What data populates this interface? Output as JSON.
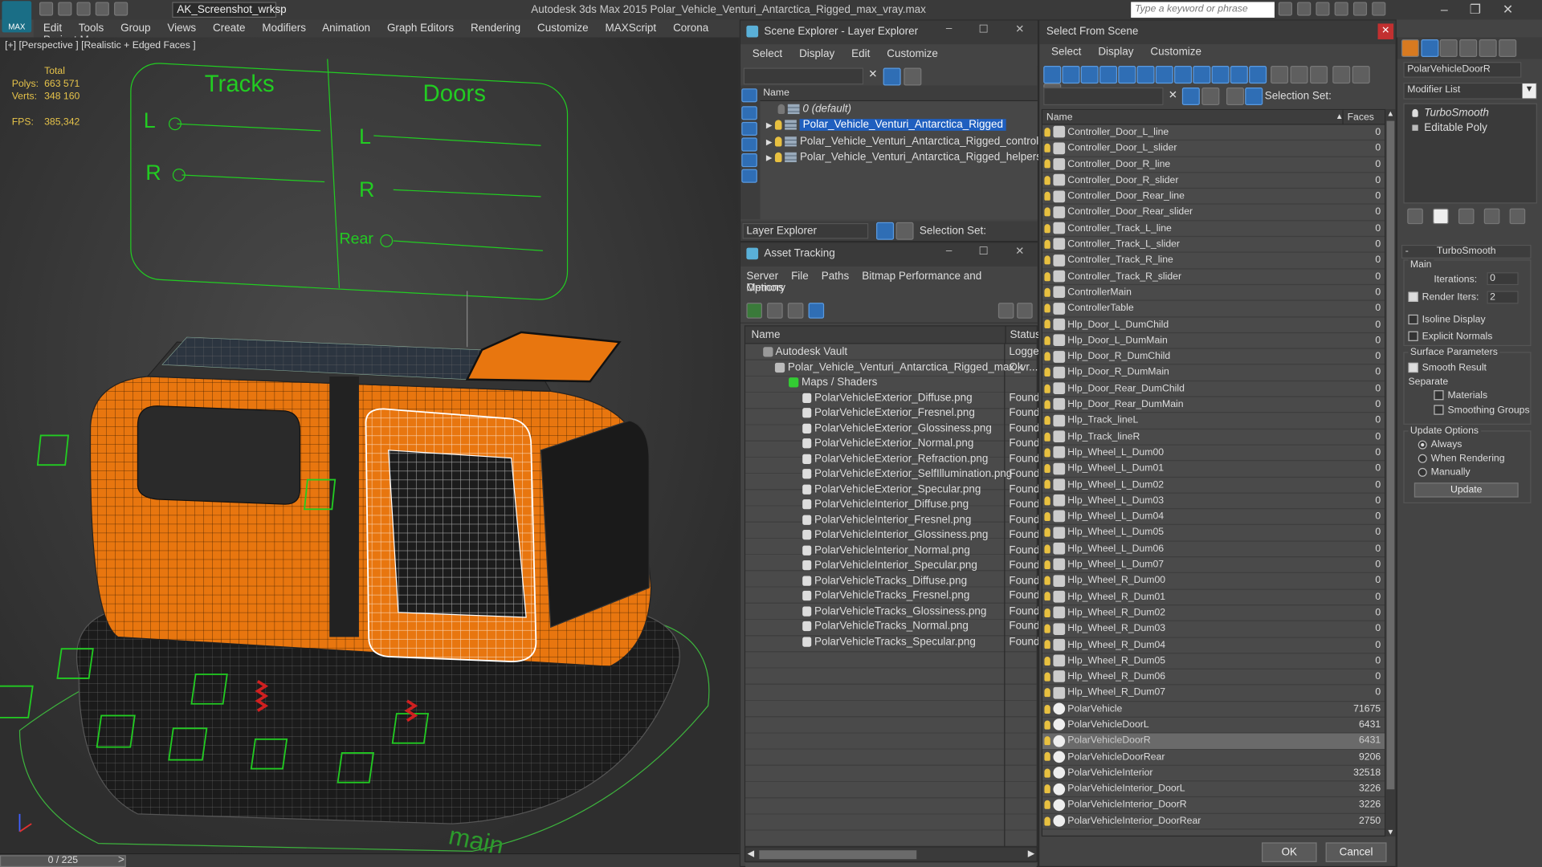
{
  "app": {
    "title": "Autodesk 3ds Max  2015     Polar_Vehicle_Venturi_Antarctica_Rigged_max_vray.max",
    "workspace": "AK_Screenshot_wrksp",
    "search_placeholder": "Type a keyword or phrase",
    "logo": "MAX"
  },
  "menu": [
    "Edit",
    "Tools",
    "Group",
    "Views",
    "Create",
    "Modifiers",
    "Animation",
    "Graph Editors",
    "Rendering",
    "Customize",
    "MAXScript",
    "Corona",
    "Project Man"
  ],
  "viewport": {
    "label": "[+] [Perspective ] [Realistic + Edged Faces ]",
    "stats": {
      "total_label": "Total",
      "polys_label": "Polys:",
      "polys": "663 571",
      "verts_label": "Verts:",
      "verts": "348 160",
      "fps_label": "FPS:",
      "fps": "385,342"
    },
    "panel": {
      "tracks": "Tracks",
      "doors": "Doors",
      "l": "L",
      "r": "R",
      "rear": "Rear"
    },
    "ground_text": "main",
    "timeline": "0 / 225"
  },
  "scene_explorer": {
    "title": "Scene Explorer - Layer Explorer",
    "menu": [
      "Select",
      "Display",
      "Edit",
      "Customize"
    ],
    "col_name": "Name",
    "layers": [
      "0 (default)",
      "Polar_Vehicle_Venturi_Antarctica_Rigged",
      "Polar_Vehicle_Venturi_Antarctica_Rigged_controller",
      "Polar_Vehicle_Venturi_Antarctica_Rigged_helpers"
    ],
    "footer_dropdown": "Layer Explorer",
    "footer_selset": "Selection Set:"
  },
  "asset_tracking": {
    "title": "Asset Tracking",
    "menu": [
      "Server",
      "File",
      "Paths",
      "Bitmap Performance and Memory"
    ],
    "menu2": "Options",
    "col_name": "Name",
    "col_status": "Status",
    "vault": "Autodesk Vault",
    "vault_status": "Logged",
    "file": "Polar_Vehicle_Venturi_Antarctica_Rigged_max_vr...",
    "file_status": "Ok",
    "maps": "Maps / Shaders",
    "items": [
      "PolarVehicleExterior_Diffuse.png",
      "PolarVehicleExterior_Fresnel.png",
      "PolarVehicleExterior_Glossiness.png",
      "PolarVehicleExterior_Normal.png",
      "PolarVehicleExterior_Refraction.png",
      "PolarVehicleExterior_SelfIllumination.png",
      "PolarVehicleExterior_Specular.png",
      "PolarVehicleInterior_Diffuse.png",
      "PolarVehicleInterior_Fresnel.png",
      "PolarVehicleInterior_Glossiness.png",
      "PolarVehicleInterior_Normal.png",
      "PolarVehicleInterior_Specular.png",
      "PolarVehicleTracks_Diffuse.png",
      "PolarVehicleTracks_Fresnel.png",
      "PolarVehicleTracks_Glossiness.png",
      "PolarVehicleTracks_Normal.png",
      "PolarVehicleTracks_Specular.png"
    ],
    "found": "Found"
  },
  "select_from_scene": {
    "title": "Select From Scene",
    "menu": [
      "Select",
      "Display",
      "Customize"
    ],
    "selset": "Selection Set:",
    "col_name": "Name",
    "col_faces": "Faces",
    "ok": "OK",
    "cancel": "Cancel",
    "objects": [
      [
        "Controller_Door_L_line",
        "0"
      ],
      [
        "Controller_Door_L_slider",
        "0"
      ],
      [
        "Controller_Door_R_line",
        "0"
      ],
      [
        "Controller_Door_R_slider",
        "0"
      ],
      [
        "Controller_Door_Rear_line",
        "0"
      ],
      [
        "Controller_Door_Rear_slider",
        "0"
      ],
      [
        "Controller_Track_L_line",
        "0"
      ],
      [
        "Controller_Track_L_slider",
        "0"
      ],
      [
        "Controller_Track_R_line",
        "0"
      ],
      [
        "Controller_Track_R_slider",
        "0"
      ],
      [
        "ControllerMain",
        "0"
      ],
      [
        "ControllerTable",
        "0"
      ],
      [
        "Hlp_Door_L_DumChild",
        "0"
      ],
      [
        "Hlp_Door_L_DumMain",
        "0"
      ],
      [
        "Hlp_Door_R_DumChild",
        "0"
      ],
      [
        "Hlp_Door_R_DumMain",
        "0"
      ],
      [
        "Hlp_Door_Rear_DumChild",
        "0"
      ],
      [
        "Hlp_Door_Rear_DumMain",
        "0"
      ],
      [
        "Hlp_Track_lineL",
        "0"
      ],
      [
        "Hlp_Track_lineR",
        "0"
      ],
      [
        "Hlp_Wheel_L_Dum00",
        "0"
      ],
      [
        "Hlp_Wheel_L_Dum01",
        "0"
      ],
      [
        "Hlp_Wheel_L_Dum02",
        "0"
      ],
      [
        "Hlp_Wheel_L_Dum03",
        "0"
      ],
      [
        "Hlp_Wheel_L_Dum04",
        "0"
      ],
      [
        "Hlp_Wheel_L_Dum05",
        "0"
      ],
      [
        "Hlp_Wheel_L_Dum06",
        "0"
      ],
      [
        "Hlp_Wheel_L_Dum07",
        "0"
      ],
      [
        "Hlp_Wheel_R_Dum00",
        "0"
      ],
      [
        "Hlp_Wheel_R_Dum01",
        "0"
      ],
      [
        "Hlp_Wheel_R_Dum02",
        "0"
      ],
      [
        "Hlp_Wheel_R_Dum03",
        "0"
      ],
      [
        "Hlp_Wheel_R_Dum04",
        "0"
      ],
      [
        "Hlp_Wheel_R_Dum05",
        "0"
      ],
      [
        "Hlp_Wheel_R_Dum06",
        "0"
      ],
      [
        "Hlp_Wheel_R_Dum07",
        "0"
      ],
      [
        "PolarVehicle",
        "71675"
      ],
      [
        "PolarVehicleDoorL",
        "6431"
      ],
      [
        "PolarVehicleDoorR",
        "6431"
      ],
      [
        "PolarVehicleDoorRear",
        "9206"
      ],
      [
        "PolarVehicleInterior",
        "32518"
      ],
      [
        "PolarVehicleInterior_DoorL",
        "3226"
      ],
      [
        "PolarVehicleInterior_DoorR",
        "3226"
      ],
      [
        "PolarVehicleInterior_DoorRear",
        "2750"
      ]
    ],
    "selected_index": 38,
    "mesh_start": 36
  },
  "command_panel": {
    "object_name": "PolarVehicleDoorR",
    "modifier_list": "Modifier List",
    "stack": [
      "TurboSmooth",
      "Editable Poly"
    ],
    "rollout": "TurboSmooth",
    "main": "Main",
    "iterations_label": "Iterations:",
    "iterations": "0",
    "render_iters_label": "Render Iters:",
    "render_iters": "2",
    "isoline": "Isoline Display",
    "explicit": "Explicit Normals",
    "surface": "Surface Parameters",
    "smooth": "Smooth Result",
    "separate": "Separate",
    "materials": "Materials",
    "smoothing": "Smoothing Groups",
    "update_options": "Update Options",
    "always": "Always",
    "when_rendering": "When Rendering",
    "manually": "Manually",
    "update": "Update"
  },
  "colors": {
    "accent": "#2f6eb5",
    "selection": "#1f5fbf",
    "wire_green": "#22cc22",
    "vehicle_orange": "#e8760f"
  }
}
